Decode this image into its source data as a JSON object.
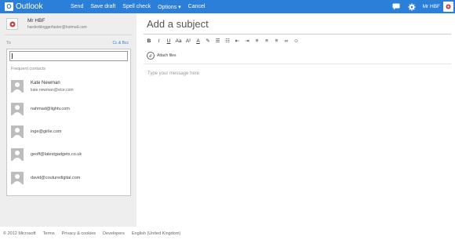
{
  "brand": {
    "name": "Outlook",
    "icon": "outlook-logo-icon",
    "icon_letter": "O"
  },
  "commands": [
    "Send",
    "Save draft",
    "Spell check",
    "Options ▾",
    "Cancel"
  ],
  "topright": {
    "icons": [
      "messaging-icon",
      "gear-icon"
    ],
    "username": "Mr HBF"
  },
  "sender": {
    "name": "Mr HBF",
    "email": "harderbloggerfaster@hotmail.com"
  },
  "to": {
    "label": "To",
    "cc_bcc": "Cc & Bcc",
    "value": ""
  },
  "frequent_label": "Frequent contacts",
  "contacts": [
    {
      "name": "Kate Newman",
      "email": "kate.newman@vice.com"
    },
    {
      "name": "",
      "email": "nahmad@lightv.com"
    },
    {
      "name": "",
      "email": "inge@girlie.com"
    },
    {
      "name": "",
      "email": "geoff@latestgadgets.co.uk"
    },
    {
      "name": "",
      "email": "david@couturedigital.com"
    }
  ],
  "compose": {
    "subject_placeholder": "Add a subject",
    "attach_label": "Attach files",
    "body_placeholder": "Type your message here"
  },
  "toolbar_glyphs": [
    "B",
    "I",
    "U",
    "Aa",
    "A²",
    "A",
    "✎",
    "☰",
    "☷",
    "⇤",
    "⇥",
    "≡",
    "≡",
    "≡",
    "∞",
    "☺"
  ],
  "footer": [
    "© 2012 Microsoft",
    "Terms",
    "Privacy & cookies",
    "Developers",
    "English (United Kingdom)"
  ],
  "colors": {
    "accent": "#2b7fd8",
    "sidebar": "#eeeeee"
  }
}
